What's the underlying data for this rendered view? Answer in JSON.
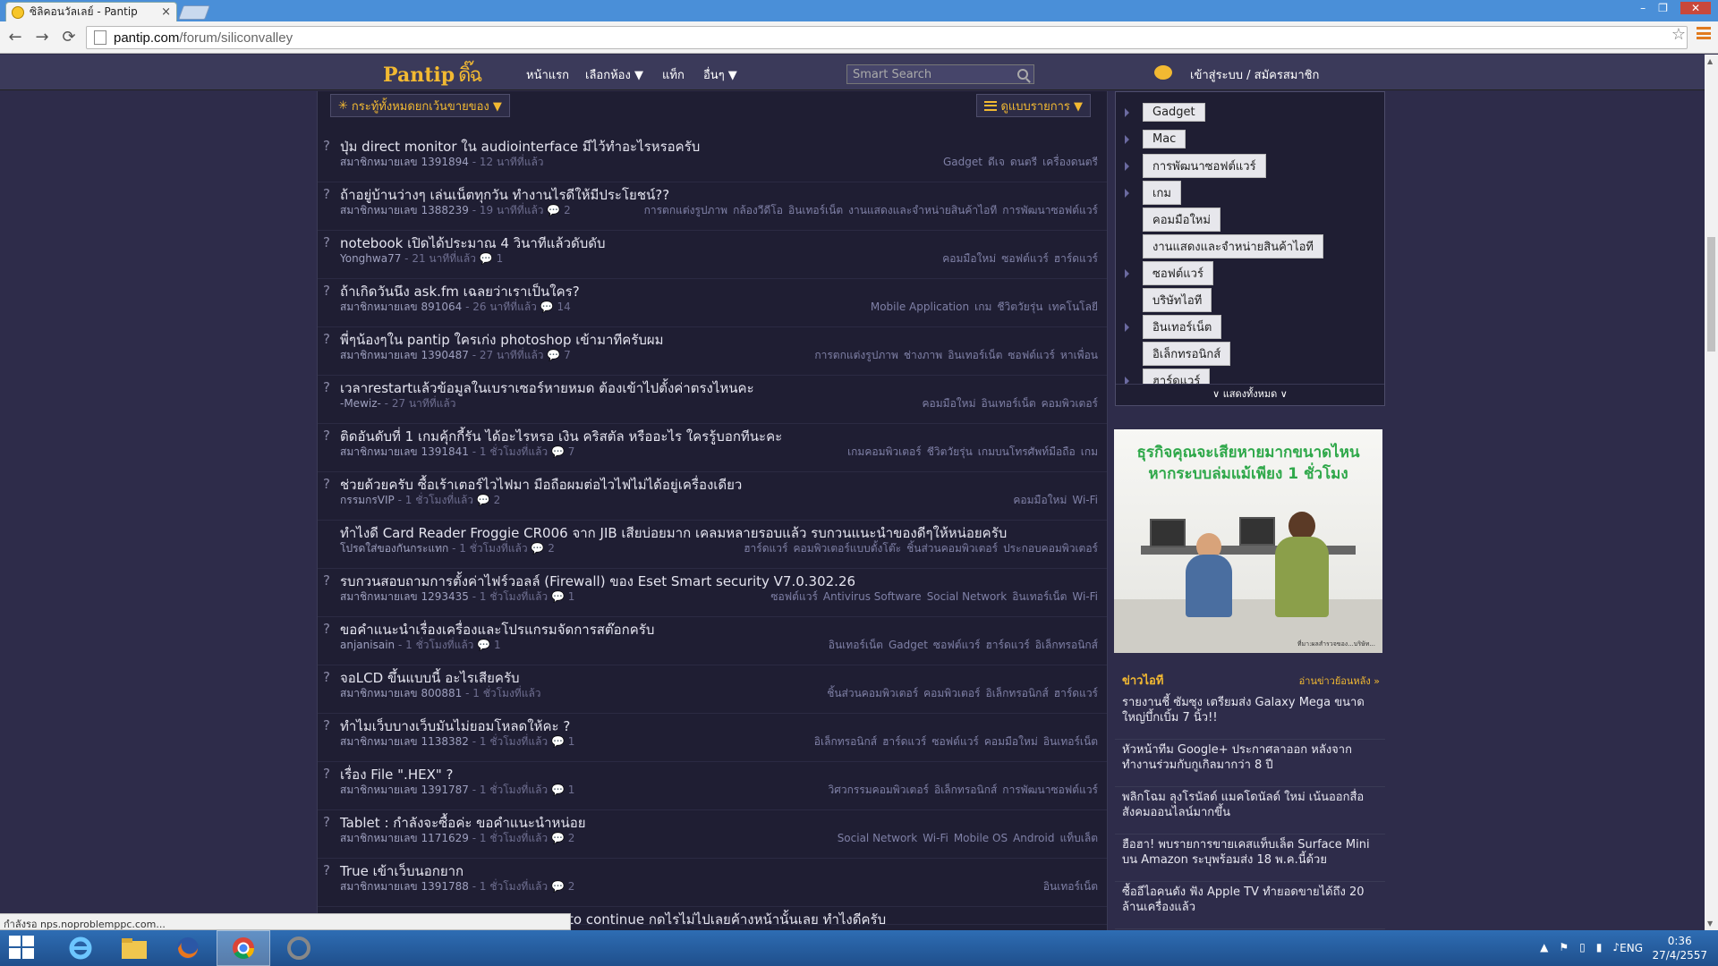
{
  "browser": {
    "tab_title": "ซิลิคอนวัลเลย์ - Pantip",
    "tab_close": "×",
    "url_domain": "pantip.com",
    "url_path": "/forum/siliconvalley",
    "window_controls": {
      "minimize": "–",
      "maximize": "❐",
      "close": "✕"
    },
    "back": "←",
    "forward": "→",
    "reload": "⟳",
    "star": "☆"
  },
  "header": {
    "logo": "Pantip",
    "logo_glyph": "ดิ๊ฉ",
    "nav": [
      "หน้าแรก",
      "เลือกห้อง ▼",
      "แท็ก",
      "อื่นๆ ▼"
    ],
    "search_placeholder": "Smart Search",
    "login": "เข้าสู่ระบบ / สมัครสมาชิก"
  },
  "filters": {
    "all": "กระทู้ทั้งหมดยกเว้นขายของ ▼",
    "all_icon": "✳",
    "view": "ดูแบบรายการ ▼"
  },
  "topics": [
    {
      "title": "ปุ่ม direct monitor ใน audiointerface มีไว้ทำอะไรหรอครับ",
      "author": "สมาชิกหมายเลข 1391894",
      "time": "12 นาทีที่แล้ว",
      "comments": "",
      "tags": [
        "Gadget",
        "ดีเจ",
        "ดนตรี",
        "เครื่องดนตรี"
      ]
    },
    {
      "title": "ถ้าอยู่บ้านว่างๆ เล่นเน็ตทุกวัน ทำงานไรดีให้มีประโยชน์??",
      "author": "สมาชิกหมายเลข 1388239",
      "time": "19 นาทีที่แล้ว",
      "comments": "2",
      "tags": [
        "การตกแต่งรูปภาพ",
        "กล้องวีดีโอ",
        "อินเทอร์เน็ต",
        "งานแสดงและจำหน่ายสินค้าไอที",
        "การพัฒนาซอฟต์แวร์"
      ]
    },
    {
      "title": "notebook เปิดได้ประมาณ 4 วินาทีแล้วดับดับ",
      "author": "Yonghwa77",
      "time": "21 นาทีที่แล้ว",
      "comments": "1",
      "tags": [
        "คอมมือใหม่",
        "ซอฟต์แวร์",
        "ฮาร์ดแวร์"
      ]
    },
    {
      "title": "ถ้าเกิดวันนึง ask.fm เฉลยว่าเราเป็นใคร?",
      "author": "สมาชิกหมายเลข 891064",
      "time": "26 นาทีที่แล้ว",
      "comments": "14",
      "tags": [
        "Mobile Application",
        "เกม",
        "ชีวิตวัยรุ่น",
        "เทคโนโลยี"
      ]
    },
    {
      "title": "พี่ๆน้องๆใน pantip ใครเก่ง photoshop เข้ามาทีครับผม",
      "author": "สมาชิกหมายเลข 1390487",
      "time": "27 นาทีที่แล้ว",
      "comments": "7",
      "tags": [
        "การตกแต่งรูปภาพ",
        "ช่างภาพ",
        "อินเทอร์เน็ต",
        "ซอฟต์แวร์",
        "หาเพื่อน"
      ]
    },
    {
      "title": "เวลาrestartแล้วข้อมูลในเบราเซอร์หายหมด ต้องเข้าไปตั้งค่าตรงไหนคะ",
      "author": "-Mewiz-",
      "time": "27 นาทีที่แล้ว",
      "comments": "",
      "tags": [
        "คอมมือใหม่",
        "อินเทอร์เน็ต",
        "คอมพิวเตอร์"
      ]
    },
    {
      "title": "ติดอันดับที่ 1 เกมคุ้กกี้รัน ได้อะไรหรอ เงิน คริสตัล หรืออะไร ใครรู้บอกทีนะคะ",
      "author": "สมาชิกหมายเลข 1391841",
      "time": "1 ชั่วโมงที่แล้ว",
      "comments": "7",
      "tags": [
        "เกมคอมพิวเตอร์",
        "ชีวิตวัยรุ่น",
        "เกมบนโทรศัพท์มือถือ",
        "เกม"
      ]
    },
    {
      "title": "ช่วยด้วยครับ ซื้อเร้าเตอร์ไวไฟมา มือถือผมต่อไวไฟไม่ได้อยู่เครื่องเดียว",
      "author": "กรรมกรVIP",
      "time": "1 ชั่วโมงที่แล้ว",
      "comments": "2",
      "tags": [
        "คอมมือใหม่",
        "Wi-Fi"
      ]
    },
    {
      "title": "ทำไงดี Card Reader Froggie CR006 จาก JIB เสียบ่อยมาก เคลมหลายรอบแล้ว รบกวนแนะนำของดีๆให้หน่อยครับ",
      "author": "โปรดใส่ของกันกระแทก",
      "time": "1 ชั่วโมงที่แล้ว",
      "comments": "2",
      "tags": [
        "ฮาร์ดแวร์",
        "คอมพิวเตอร์แบบตั้งโต๊ะ",
        "ชิ้นส่วนคอมพิวเตอร์",
        "ประกอบคอมพิวเตอร์"
      ],
      "no_q": true
    },
    {
      "title": "รบกวนสอบถามการตั้งค่าไฟร์วอลล์ (Firewall) ของ Eset Smart security V7.0.302.26",
      "author": "สมาชิกหมายเลข 1293435",
      "time": "1 ชั่วโมงที่แล้ว",
      "comments": "1",
      "tags": [
        "ซอฟต์แวร์",
        "Antivirus Software",
        "Social Network",
        "อินเทอร์เน็ต",
        "Wi-Fi"
      ]
    },
    {
      "title": "ขอคำแนะนำเรื่องเครื่องและโปรแกรมจัดการสต๊อกครับ",
      "author": "anjanisain",
      "time": "1 ชั่วโมงที่แล้ว",
      "comments": "1",
      "tags": [
        "อินเทอร์เน็ต",
        "Gadget",
        "ซอฟต์แวร์",
        "ฮาร์ดแวร์",
        "อิเล็กทรอนิกส์"
      ]
    },
    {
      "title": "จอLCD ขึ้นแบบนี้ อะไรเสียครับ",
      "author": "สมาชิกหมายเลข 800881",
      "time": "1 ชั่วโมงที่แล้ว",
      "comments": "",
      "tags": [
        "ชิ้นส่วนคอมพิวเตอร์",
        "คอมพิวเตอร์",
        "อิเล็กทรอนิกส์",
        "ฮาร์ดแวร์"
      ]
    },
    {
      "title": "ทำไมเว็บบางเว็บมันไม่ยอมโหลดให้คะ ?",
      "author": "สมาชิกหมายเลข 1138382",
      "time": "1 ชั่วโมงที่แล้ว",
      "comments": "1",
      "tags": [
        "อิเล็กทรอนิกส์",
        "ฮาร์ดแวร์",
        "ซอฟต์แวร์",
        "คอมมือใหม่",
        "อินเทอร์เน็ต"
      ]
    },
    {
      "title": "เรื่อง File \".HEX\" ?",
      "author": "สมาชิกหมายเลข 1391787",
      "time": "1 ชั่วโมงที่แล้ว",
      "comments": "1",
      "tags": [
        "วิศวกรรมคอมพิวเตอร์",
        "อิเล็กทรอนิกส์",
        "การพัฒนาซอฟต์แวร์"
      ]
    },
    {
      "title": "Tablet : กำลังจะซื้อค่ะ ขอคำแนะนำหน่อย",
      "author": "สมาชิกหมายเลข 1171629",
      "time": "1 ชั่วโมงที่แล้ว",
      "comments": "2",
      "tags": [
        "Social Network",
        "Wi-Fi",
        "Mobile OS",
        "Android",
        "แท็บเล็ต"
      ]
    },
    {
      "title": "True เข้าเว็บนอกยาก",
      "author": "สมาชิกหมายเลข 1391788",
      "time": "1 ชั่วโมงที่แล้ว",
      "comments": "2",
      "tags": [
        "อินเทอร์เน็ต"
      ]
    },
    {
      "title": "to continue กดไรไม่ไปเลยค้างหน้านั้นเลย ทำไงดีครับ",
      "author": "",
      "time": "",
      "comments": "",
      "tags": [],
      "partial": true
    }
  ],
  "sidebar": {
    "categories": [
      "Gadget",
      "Mac",
      "การพัฒนาซอฟต์แวร์",
      "เกม",
      "คอมมือใหม่",
      "งานแสดงและจำหน่ายสินค้าไอที",
      "ซอฟต์แวร์",
      "บริษัทไอที",
      "อินเทอร์เน็ต",
      "อิเล็กทรอนิกส์",
      "ฮาร์ดแวร์"
    ],
    "has_arrow": [
      true,
      true,
      true,
      true,
      false,
      false,
      true,
      false,
      true,
      false,
      true
    ],
    "show_all": "∨ แสดงทั้งหมด ∨"
  },
  "ad": {
    "headline_1": "ธุรกิจคุณจะเสียหายมากขนาดไหน",
    "headline_2": "หากระบบล่มแม้เพียง 1 ชั่วโมง",
    "fine_print": "ที่มา:ผลสำรวจของ...บริษัท..."
  },
  "news": {
    "title": "ข่าวไอที",
    "more": "อ่านข่าวย้อนหลัง »",
    "items": [
      "รายงานชี้ ซัมซุง เตรียมส่ง Galaxy Mega ขนาดใหญ่บึ้กเบิ้ม 7 นิ้ว!!",
      "หัวหน้าทีม Google+ ประกาศลาออก หลังจากทำงานร่วมกับกูเกิลมากว่า 8 ปี",
      "พลิกโฉม ลุงโรนัลด์ แมคโดนัลด์ ใหม่ เน้นออกสื่อสังคมออนไลน์มากขึ้น",
      "ฮือฮา! พบรายการขายเคสแท็บเล็ต Surface Mini บน Amazon ระบุพร้อมส่ง 18 พ.ค.นี้ด้วย",
      "ซื้ออีไอคนดัง ฟัง Apple TV ทำยอดขายได้ถึง 20 ล้านเครื่องแล้ว"
    ]
  },
  "status_bar": "กำลังรอ nps.noproblemppc.com...",
  "taskbar": {
    "lang": "ENG",
    "time": "0:36",
    "date": "27/4/2557"
  },
  "colors": {
    "accent": "#f2b932",
    "page_bg": "#2e2c4a",
    "panel_bg": "#1f1e33"
  }
}
